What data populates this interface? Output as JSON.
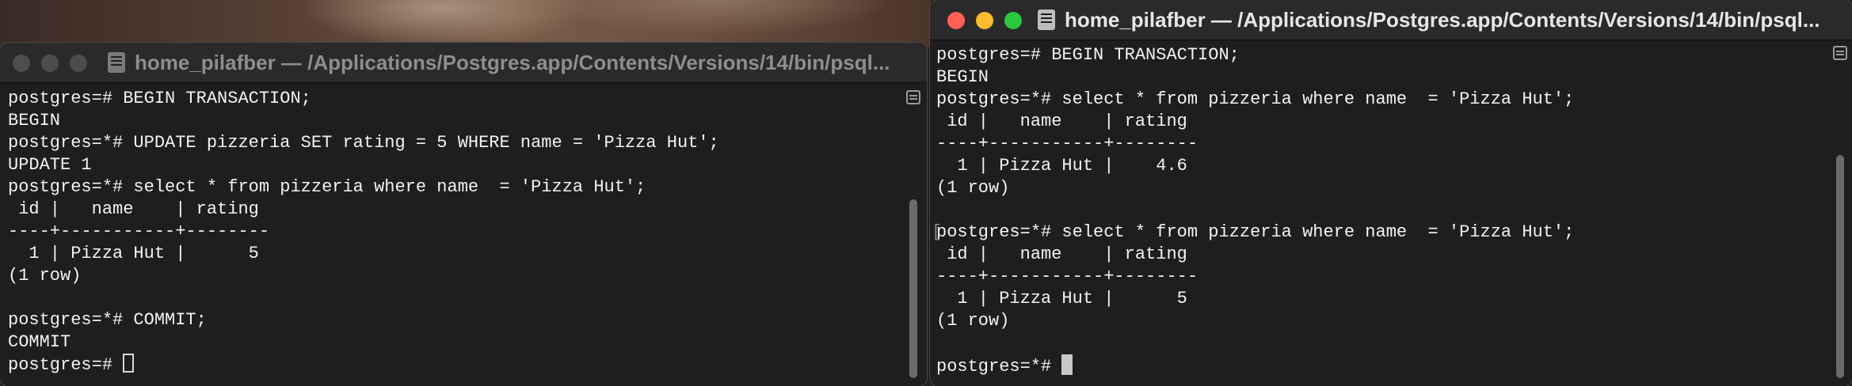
{
  "colors": {
    "close": "#ff5f57",
    "minimize": "#febc2e",
    "zoom": "#28c840",
    "inactive_light": "#4d4d4d",
    "active_title": "#e6e6e6",
    "inactive_title": "#8e8e8e"
  },
  "left_window": {
    "title": "home_pilafber — /Applications/Postgres.app/Contents/Versions/14/bin/psql...",
    "active": false,
    "lines": [
      "postgres=# BEGIN TRANSACTION;",
      "BEGIN",
      "postgres=*# UPDATE pizzeria SET rating = 5 WHERE name = 'Pizza Hut';",
      "UPDATE 1",
      "postgres=*# select * from pizzeria where name  = 'Pizza Hut';",
      " id |   name    | rating",
      "----+-----------+--------",
      "  1 | Pizza Hut |      5",
      "(1 row)",
      "",
      "postgres=*# COMMIT;",
      "COMMIT"
    ],
    "prompt": "postgres=# "
  },
  "right_window": {
    "title": "home_pilafber — /Applications/Postgres.app/Contents/Versions/14/bin/psql...",
    "active": true,
    "lines": [
      "postgres=# BEGIN TRANSACTION;",
      "BEGIN",
      "postgres=*# select * from pizzeria where name  = 'Pizza Hut';",
      " id |   name    | rating",
      "----+-----------+--------",
      "  1 | Pizza Hut |    4.6",
      "(1 row)",
      "",
      "postgres=*# select * from pizzeria where name  = 'Pizza Hut';",
      " id |   name    | rating",
      "----+-----------+--------",
      "  1 | Pizza Hut |      5",
      "(1 row)",
      ""
    ],
    "marker": "[",
    "prompt": "postgres=*# "
  },
  "icons": {
    "terminal": "terminal-document-icon",
    "scroll_menu": "scrollback-menu-icon"
  }
}
